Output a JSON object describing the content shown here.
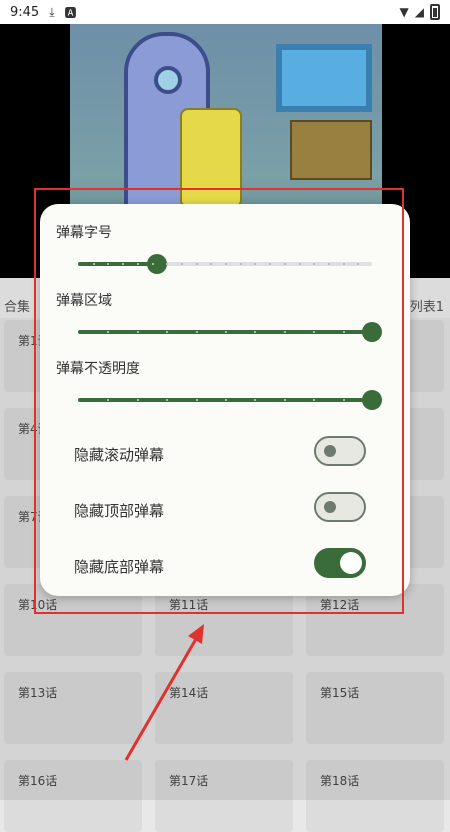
{
  "status_bar": {
    "time": "9:45",
    "icons": [
      "download-icon",
      "text-a-icon",
      "wifi-icon",
      "signal-icon",
      "battery-icon"
    ]
  },
  "background": {
    "tab_left": "合集",
    "tab_right": "列表1",
    "episodes": [
      "第1话",
      "第4话",
      "第7话",
      "第10话",
      "第11话",
      "第12话",
      "第13话",
      "第14话",
      "第15话",
      "第16话",
      "第17话",
      "第18话"
    ]
  },
  "panel": {
    "sliders": [
      {
        "label": "弹幕字号",
        "value": 0.27
      },
      {
        "label": "弹幕区域",
        "value": 1.0
      },
      {
        "label": "弹幕不透明度",
        "value": 1.0
      }
    ],
    "toggles": [
      {
        "label": "隐藏滚动弹幕",
        "on": false
      },
      {
        "label": "隐藏顶部弹幕",
        "on": false
      },
      {
        "label": "隐藏底部弹幕",
        "on": true
      }
    ]
  },
  "colors": {
    "accent": "#3a6b3b",
    "annotation": "#e0322d"
  }
}
